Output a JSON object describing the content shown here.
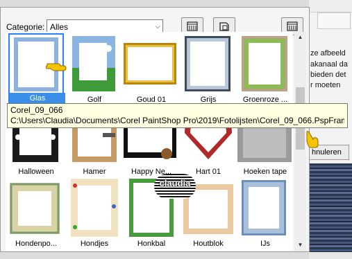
{
  "background": {
    "right_lines": [
      "ze afbeeld",
      "akanaal da",
      "bieden det",
      "r moeten"
    ],
    "button_label": "hnuleren"
  },
  "toolbar": {
    "category_label": "Categorie:",
    "category_value": "Alles"
  },
  "items": [
    {
      "label": "Glas",
      "selected": true
    },
    {
      "label": "Golf"
    },
    {
      "label": "Goud 01"
    },
    {
      "label": "Grijs"
    },
    {
      "label": "Groenroze ..."
    },
    {
      "label": "Halloween"
    },
    {
      "label": "Hamer"
    },
    {
      "label": "Happy Ne..."
    },
    {
      "label": "Hart 01"
    },
    {
      "label": "Hoeken tape"
    },
    {
      "label": "Hondenpo..."
    },
    {
      "label": "Hondjes"
    },
    {
      "label": "Honkbal"
    },
    {
      "label": "Houtblok"
    },
    {
      "label": "IJs"
    }
  ],
  "tooltip": {
    "line1": "Corel_09_066",
    "line2": "C:\\Users\\Claudia\\Documents\\Corel PaintShop Pro\\2019\\Fotolijsten\\Corel_09_066.PspFrame"
  },
  "watermark": "claudia",
  "colors": {
    "selection": "#3b8fe8",
    "tooltip_bg": "#ffffe1",
    "pointer": "#f5c400"
  }
}
